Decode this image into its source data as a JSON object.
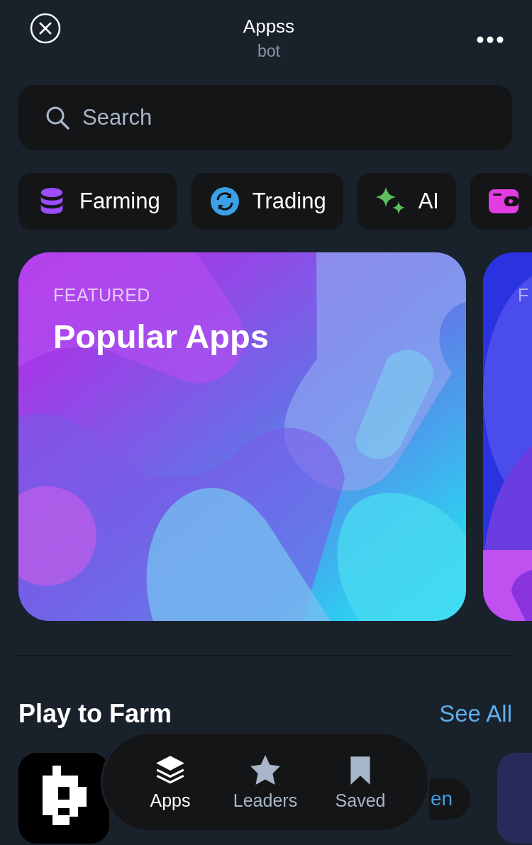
{
  "header": {
    "title": "Appss",
    "subtitle": "bot"
  },
  "search": {
    "placeholder": "Search"
  },
  "categories": [
    {
      "kind": "database",
      "label": "Farming"
    },
    {
      "kind": "sync",
      "label": "Trading"
    },
    {
      "kind": "sparkle",
      "label": "AI"
    },
    {
      "kind": "wallet"
    }
  ],
  "cards": [
    {
      "kind": "picture",
      "eyebrow": "FEATURED",
      "title": "Popular Apps"
    },
    {
      "kind": "picture",
      "eyebrow": "F"
    }
  ],
  "section": {
    "title": "Play to Farm",
    "link": "See All",
    "open_button": "en"
  },
  "nav": [
    {
      "kind": "stack",
      "label": "Apps",
      "selected": true
    },
    {
      "kind": "star",
      "label": "Leaders",
      "selected": false
    },
    {
      "kind": "bookmark",
      "label": "Saved",
      "selected": false
    }
  ]
}
